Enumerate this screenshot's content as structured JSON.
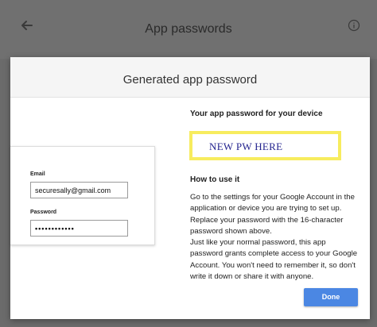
{
  "background": {
    "title": "App passwords",
    "icons": {
      "back": "arrow-left-icon",
      "info": "info-icon"
    }
  },
  "dialog": {
    "title": "Generated app password",
    "signin_example": {
      "email_label": "Email",
      "email_value": "securesally@gmail.com",
      "password_label": "Password",
      "password_value": "••••••••••••"
    },
    "password_heading": "Your app password for your device",
    "password_value": "NEW PW HERE",
    "howto_heading": "How to use it",
    "howto_paragraph1": "Go to the settings for your Google Account in the application or device you are trying to set up. Replace your password with the 16-character password shown above.",
    "howto_paragraph2": "Just like your normal password, this app password grants complete access to your Google Account. You won't need to remember it, so don't write it down or share it with anyone.",
    "done_label": "Done"
  },
  "colors": {
    "overlay": "#6b6b6b",
    "highlight": "#f7ec5e",
    "password_text": "#24248f",
    "button": "#4b87e3"
  }
}
